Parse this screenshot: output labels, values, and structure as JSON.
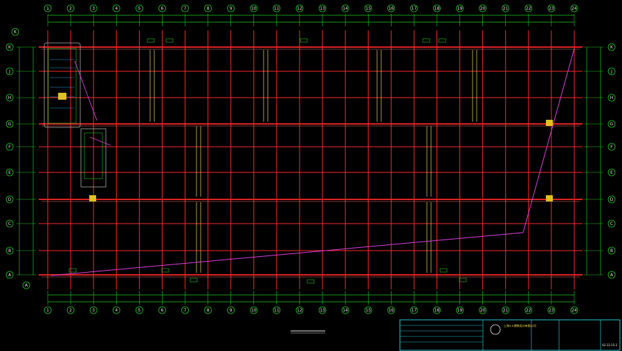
{
  "drawing": {
    "column_axes": [
      "1",
      "2",
      "3",
      "4",
      "5",
      "6",
      "7",
      "8",
      "9",
      "10",
      "11",
      "12",
      "13",
      "14",
      "15",
      "16",
      "17",
      "18",
      "19",
      "20",
      "21",
      "22",
      "23",
      "24"
    ],
    "row_axes": [
      "K",
      "J",
      "H",
      "G",
      "F",
      "E",
      "D",
      "C",
      "B",
      "A"
    ],
    "callout_left_top": "K",
    "callout_left_bottom": "A",
    "detail_markers": [
      "K",
      "G",
      "F",
      "E",
      "A"
    ],
    "colors": {
      "background": "#000000",
      "axis_red": "#ff2a2a",
      "dimension_green": "#1fd01f",
      "stair_yellow": "#d8c060",
      "leader_magenta": "#e040e0",
      "titleblock_cyan": "#28c8d8",
      "bubble": "#e8e8e8"
    }
  },
  "title_block": {
    "company": "上海××建筑设计有限公司",
    "sheet_no": "A2-12-15-2"
  }
}
